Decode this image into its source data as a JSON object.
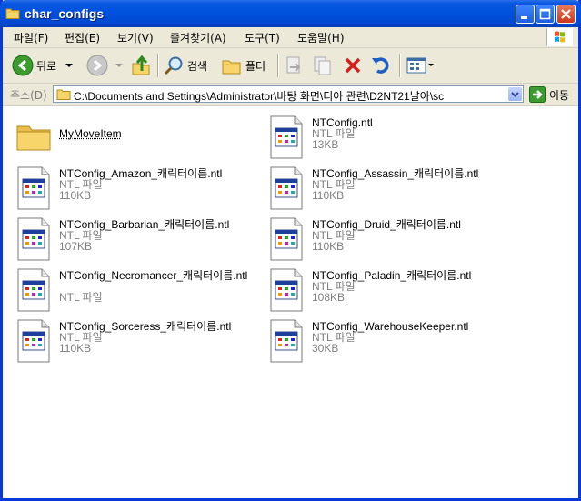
{
  "window": {
    "title": "char_configs"
  },
  "menu": [
    "파일(F)",
    "편집(E)",
    "보기(V)",
    "즐겨찾기(A)",
    "도구(T)",
    "도움말(H)"
  ],
  "toolbar": {
    "back": "뒤로",
    "search": "검색",
    "folders": "폴더"
  },
  "address": {
    "label": "주소(D)",
    "path": "C:\\Documents and Settings\\Administrator\\바탕 화면\\디아 관련\\D2NT21날아\\sc",
    "go": "이동"
  },
  "files": [
    {
      "name": "MyMoveItem",
      "type": "",
      "size": "",
      "kind": "folder"
    },
    {
      "name": "NTConfig.ntl",
      "type": "NTL 파일",
      "size": "13KB",
      "kind": "file"
    },
    {
      "name": "NTConfig_Amazon_캐릭터이름.ntl",
      "type": "NTL 파일",
      "size": "110KB",
      "kind": "file"
    },
    {
      "name": "NTConfig_Assassin_캐릭터이름.ntl",
      "type": "NTL 파일",
      "size": "110KB",
      "kind": "file"
    },
    {
      "name": "NTConfig_Barbarian_캐릭터이름.ntl",
      "type": "NTL 파일",
      "size": "107KB",
      "kind": "file"
    },
    {
      "name": "NTConfig_Druid_캐릭터이름.ntl",
      "type": "NTL 파일",
      "size": "110KB",
      "kind": "file"
    },
    {
      "name": "NTConfig_Necromancer_캐릭터이름.ntl",
      "type": "NTL 파일",
      "size": "",
      "kind": "file",
      "wrap": true
    },
    {
      "name": "NTConfig_Paladin_캐릭터이름.ntl",
      "type": "NTL 파일",
      "size": "108KB",
      "kind": "file"
    },
    {
      "name": "NTConfig_Sorceress_캐릭터이름.ntl",
      "type": "NTL 파일",
      "size": "110KB",
      "kind": "file"
    },
    {
      "name": "NTConfig_WarehouseKeeper.ntl",
      "type": "NTL 파일",
      "size": "30KB",
      "kind": "file"
    }
  ]
}
